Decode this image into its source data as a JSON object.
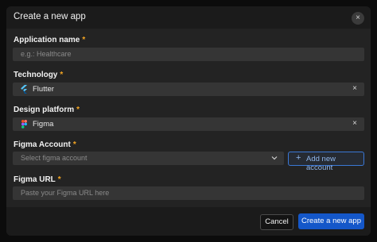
{
  "dialog": {
    "title": "Create a new app",
    "close_glyph": "×"
  },
  "fields": {
    "app_name": {
      "label": "Application name",
      "required_mark": "*",
      "placeholder": "e.g.: Healthcare"
    },
    "technology": {
      "label": "Technology",
      "required_mark": "*",
      "value": "Flutter",
      "icon": "flutter-icon",
      "clear_glyph": "×"
    },
    "design_platform": {
      "label": "Design platform",
      "required_mark": "*",
      "value": "Figma",
      "icon": "figma-icon",
      "clear_glyph": "×"
    },
    "figma_account": {
      "label": "Figma Account",
      "required_mark": "*",
      "placeholder": "Select figma account",
      "add_button": "Add new account",
      "add_glyph": "+"
    },
    "figma_url": {
      "label": "Figma URL",
      "required_mark": "*",
      "placeholder": "Paste your Figma URL here"
    }
  },
  "footer": {
    "cancel_label": "Cancel",
    "create_label": "Create a new app"
  },
  "colors": {
    "background": "#0c0c0c",
    "modal": "#232323",
    "field": "#353535",
    "required": "#f5a623",
    "primary": "#1457c9",
    "link_border": "#3a78d6"
  }
}
